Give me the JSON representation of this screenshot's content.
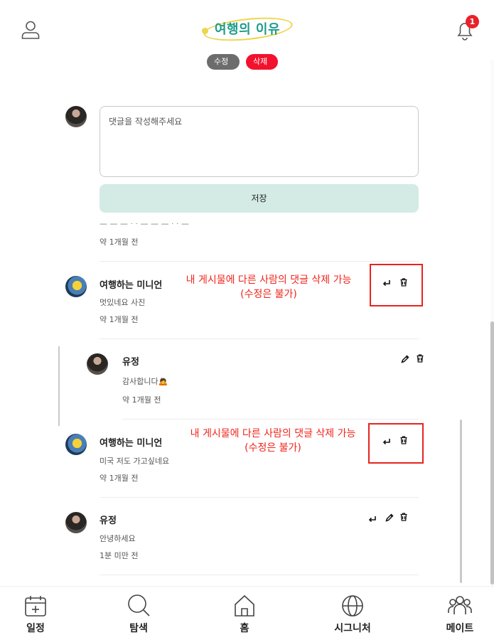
{
  "header": {
    "logo_text": "여행의 이유",
    "notification_count": "1"
  },
  "post_actions": {
    "edit_label": "수정",
    "delete_label": "삭제"
  },
  "comment_form": {
    "placeholder": "댓글을 작성해주세요",
    "save_label": "저장"
  },
  "comments": [
    {
      "time": "약 1개월 전"
    },
    {
      "author": "여행하는 미니언",
      "text": "멋있네요 사진",
      "time": "약 1개월 전",
      "annotation_line1": "내 게시물에 다른 사람의 댓글 삭제 가능",
      "annotation_line2": "(수정은 불가)"
    },
    {
      "author": "유정",
      "text": "감사합니다🙇",
      "time": "약 1개월 전"
    },
    {
      "author": "여행하는 미니언",
      "text": "미국 저도 가고싶네요",
      "time": "약 1개월 전",
      "annotation_line1": "내 게시물에 다른 사람의 댓글 삭제 가능",
      "annotation_line2": "(수정은 불가)"
    },
    {
      "author": "유정",
      "text": "안녕하세요",
      "time": "1분 미만 전"
    }
  ],
  "bottom_nav": [
    {
      "label": "일정",
      "icon": "calendar-icon"
    },
    {
      "label": "탐색",
      "icon": "search-icon"
    },
    {
      "label": "홈",
      "icon": "home-icon"
    },
    {
      "label": "시그니처",
      "icon": "globe-icon"
    },
    {
      "label": "메이트",
      "icon": "people-icon"
    }
  ],
  "colors": {
    "accent": "#1e9c8c",
    "save_button": "#d3ebe4",
    "delete_chip": "#f2122d",
    "edit_chip": "#6c6c6c",
    "annotation": "#e8231d"
  }
}
